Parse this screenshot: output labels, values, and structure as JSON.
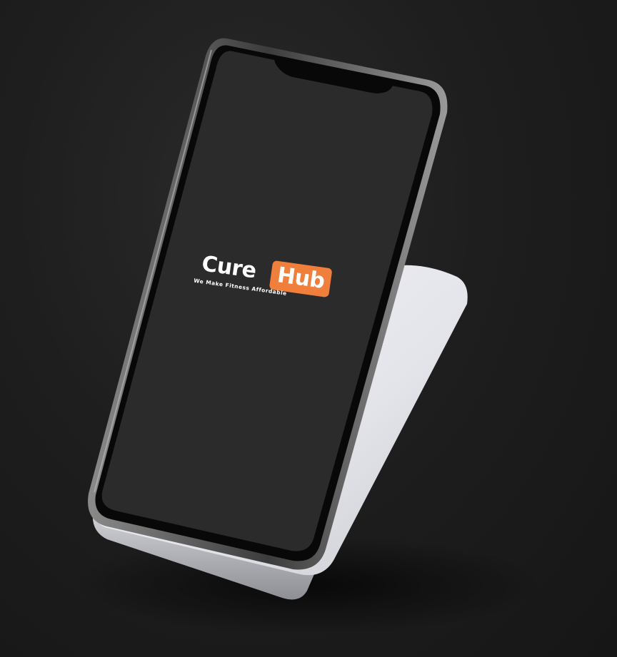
{
  "brand": {
    "name_part1": "Cure",
    "name_part2": "Hub",
    "tagline": "We Make Fitness Affordable"
  },
  "colors": {
    "background": "#1c1c1c",
    "screen": "#2b2b2b",
    "accent": "#f07f3c",
    "stand": "#e8e9ee",
    "text": "#ffffff"
  },
  "icons": {
    "device": "smartphone-icon",
    "stand": "phone-stand-icon"
  }
}
